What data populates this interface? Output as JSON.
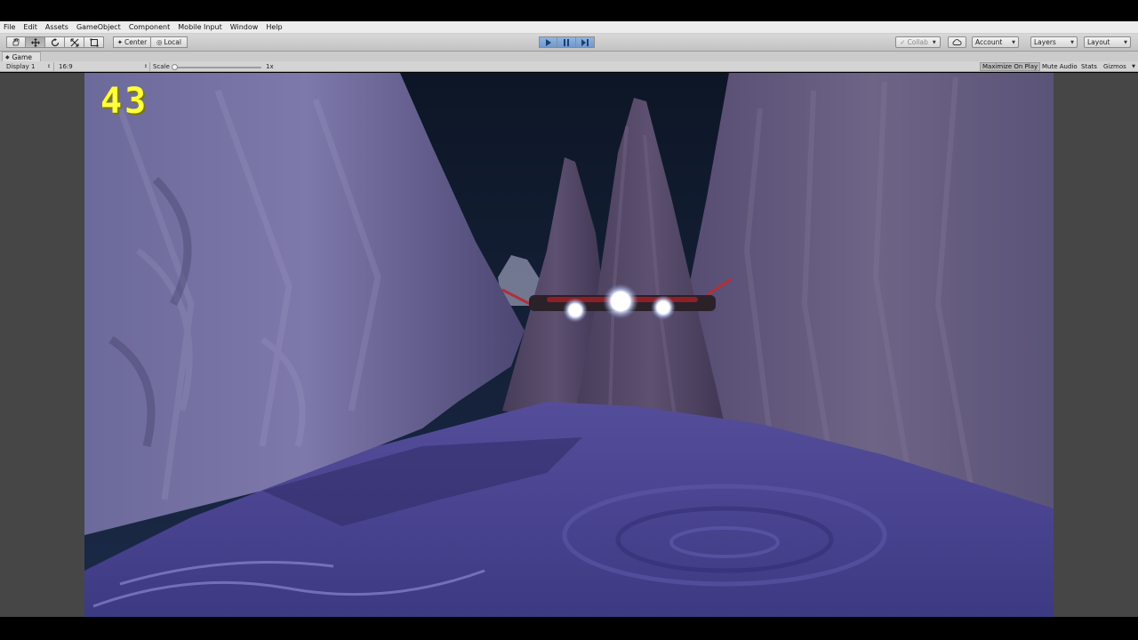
{
  "menu": [
    "File",
    "Edit",
    "Assets",
    "GameObject",
    "Component",
    "Mobile Input",
    "Window",
    "Help"
  ],
  "toolbar": {
    "pivot_center": "Center",
    "pivot_local": "Local",
    "collab": "Collab",
    "account": "Account",
    "layers": "Layers",
    "layout": "Layout"
  },
  "tab": {
    "title": "Game"
  },
  "gamebar": {
    "display": "Display 1",
    "aspect": "16:9",
    "scale_label": "Scale",
    "scale_value": "1x",
    "maximize_on_play": "Maximize On Play",
    "mute_audio": "Mute Audio",
    "stats": "Stats",
    "gizmos": "Gizmos"
  },
  "game": {
    "score": "43"
  },
  "colors": {
    "score": "#ffff3a",
    "play_active": "#6f98cc",
    "sky": "#0f1a2e",
    "rock": "#6a5f8c",
    "water": "#4a4490"
  },
  "icons": [
    "hand-icon",
    "move-icon",
    "rotate-icon",
    "scale-icon",
    "rect-tool-icon",
    "play-icon",
    "pause-icon",
    "step-icon",
    "cloud-icon",
    "game-tab-icon"
  ]
}
